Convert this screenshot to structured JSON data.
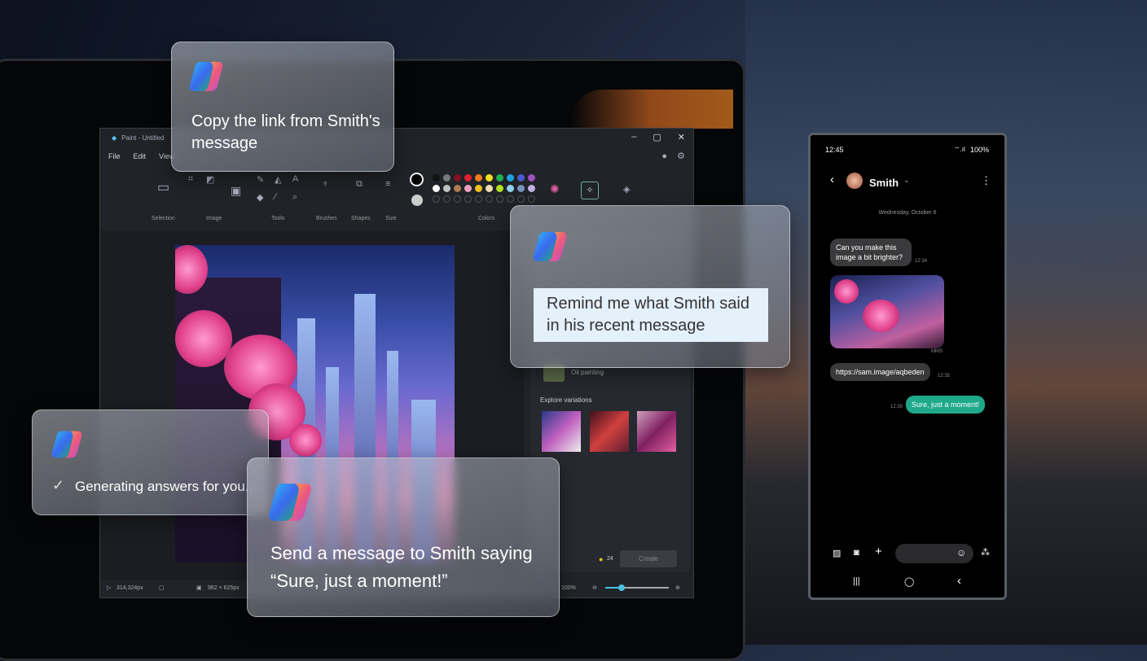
{
  "paint": {
    "title": "Paint - Untitled",
    "menu": [
      "File",
      "Edit",
      "View"
    ],
    "window_controls": {
      "minimize": "–",
      "maximize": "▢",
      "close": "✕"
    },
    "groups": [
      "Selection",
      "Image",
      "Tools",
      "Brushes",
      "Shapes",
      "Size",
      "Colors"
    ],
    "colors_row1": [
      "#111111",
      "#7a7a7a",
      "#8a1020",
      "#e02030",
      "#f07a20",
      "#f0e020",
      "#20b050",
      "#20a0e0",
      "#4a5ad0",
      "#a050c0"
    ],
    "colors_row2": [
      "#ffffff",
      "#c0c0c0",
      "#b07a50",
      "#f0a0c0",
      "#f0c020",
      "#f0e0b0",
      "#b0e020",
      "#90d0f0",
      "#7a90c0",
      "#c0b0e0"
    ],
    "panel": {
      "style_label": "Oil painting",
      "explore_label": "Explore variations",
      "credits": "24",
      "create_button": "Create"
    },
    "status": {
      "cursor": "314,324px",
      "canvas_size": "962 × 625px",
      "zoom": "100%"
    },
    "zoom_level": 0.25
  },
  "cards": {
    "copy_link": "Copy the link from Smith's message",
    "remind": "Remind me what Smith said in his recent message",
    "generating": "Generating answers for you...",
    "send": "Send a message to Smith saying “Sure, just a moment!”"
  },
  "phone": {
    "time": "12:45",
    "battery": "100%",
    "contact": "Smith",
    "date": "Wednesday, October 6",
    "messages": [
      {
        "text": "Can you make this image a bit brighter?",
        "time": "12:34"
      },
      {
        "text": "MMS"
      },
      {
        "text": "https://sam.image/aqbeden",
        "time": "12:35"
      },
      {
        "text": "Sure, just a moment!",
        "time": "12:39"
      }
    ],
    "accent": "#1fa98a"
  }
}
